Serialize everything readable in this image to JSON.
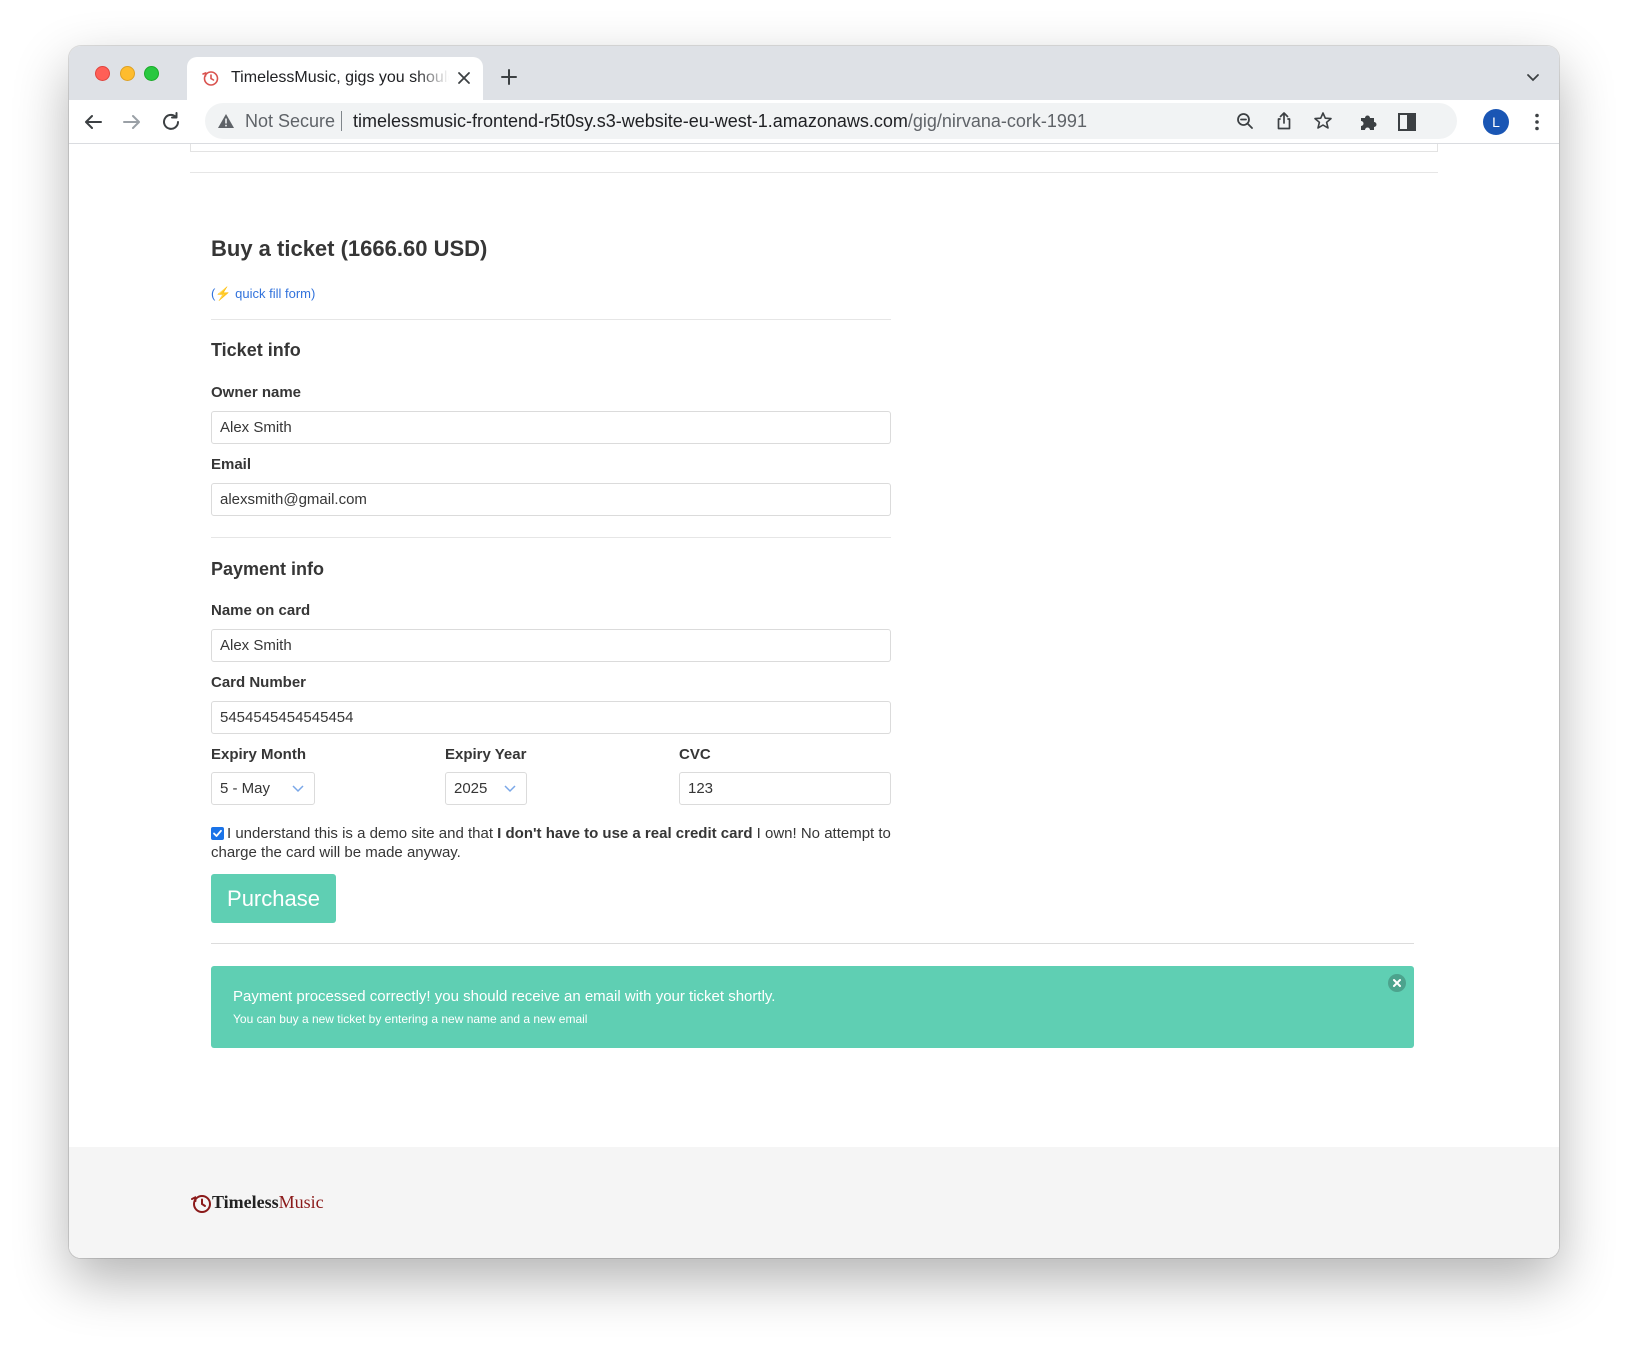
{
  "browser": {
    "tab": {
      "title": "TimelessMusic, gigs you should never have missed"
    },
    "address": {
      "security_label": "Not Secure",
      "url_host": "timelessmusic-frontend-r5t0sy.s3-website-eu-west-1.amazonaws.com",
      "url_path": "/gig/nirvana-cork-1991"
    },
    "profile_initial": "L"
  },
  "form": {
    "title": "Buy a ticket (1666.60 USD)",
    "quick_fill_open": "(",
    "quick_fill_icon": "⚡",
    "quick_fill_label": " quick fill form",
    "quick_fill_close": ")",
    "ticket_section": "Ticket info",
    "owner_label": "Owner name",
    "owner_value": "Alex Smith",
    "email_label": "Email",
    "email_value": "alexsmith@gmail.com",
    "payment_section": "Payment info",
    "card_name_label": "Name on card",
    "card_name_value": "Alex Smith",
    "card_number_label": "Card Number",
    "card_number_value": "5454545454545454",
    "expiry_month_label": "Expiry Month",
    "expiry_month_value": "5 - May",
    "expiry_year_label": "Expiry Year",
    "expiry_year_value": "2025",
    "cvc_label": "CVC",
    "cvc_value": "123",
    "agree_checked": true,
    "agree_text_1": "I understand this is a demo site and that ",
    "agree_text_bold": "I don't have to use a real credit card",
    "agree_text_2": " I own! No attempt to charge the card will be made anyway.",
    "purchase_label": "Purchase"
  },
  "notification": {
    "message": "Payment processed correctly! you should receive an email with your ticket shortly.",
    "submessage": "You can buy a new ticket by entering a new name and a new email"
  },
  "footer": {
    "logo_part1": "Timeless",
    "logo_part2": "Music"
  },
  "colors": {
    "accent": "#5fcfb3",
    "link": "#3273dc",
    "logo_red": "#8b1a1a"
  },
  "icons": [
    "back-arrow-icon",
    "forward-arrow-icon",
    "reload-icon",
    "warning-icon",
    "zoom-icon",
    "share-icon",
    "star-icon",
    "extensions-icon",
    "side-panel-icon",
    "more-menu-icon",
    "chevron-down-icon",
    "close-icon",
    "plus-icon",
    "timeless-clock-icon"
  ]
}
